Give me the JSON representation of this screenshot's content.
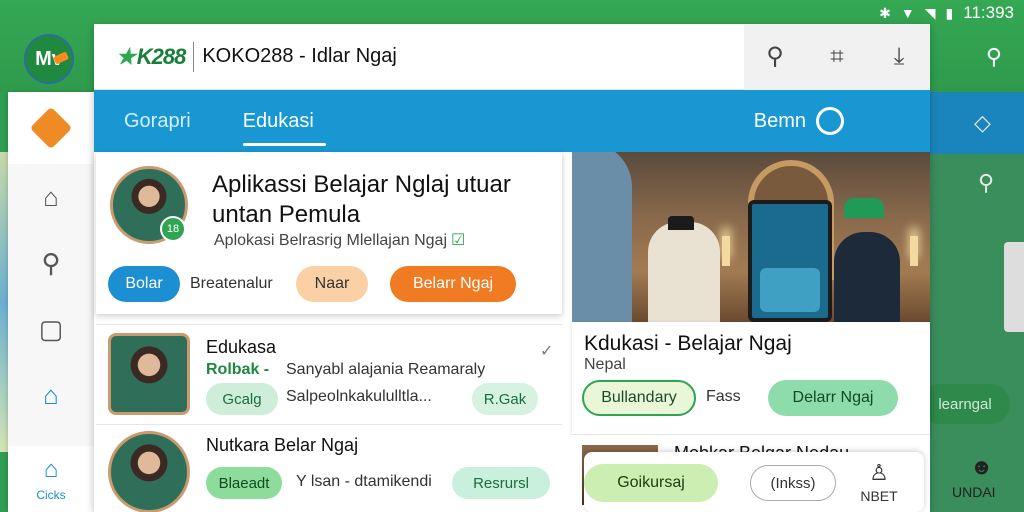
{
  "status_bar": {
    "time": "11:393",
    "icons": [
      "bluetooth-icon",
      "signal-icon",
      "wifi-icon",
      "battery-icon"
    ]
  },
  "app_logo": "Mv",
  "header": {
    "brand": "K288",
    "title": "KOKO288 - Idlar Ngaj",
    "tools": [
      "search-icon",
      "grid-icon",
      "download-icon"
    ]
  },
  "tabs": {
    "items": [
      {
        "label": "Gorapri"
      },
      {
        "label": "Edukasi"
      }
    ],
    "right_label": "Bemn"
  },
  "sidebar": {
    "bottom_label": "Cicks"
  },
  "hero": {
    "title": "Aplikassi Belajar Nglaj utuar untan Pemula",
    "subtitle": "Aplokasi Belrasrig Mlellajan Ngaj",
    "badge": "18",
    "btn_blue": "Bolar",
    "plain_text": "Breatenalur",
    "btn_peach": "Naar",
    "btn_orange": "Belarr Ngaj"
  },
  "list": [
    {
      "title": "Edukasa",
      "green_label": "Rolbak -",
      "line1": "Sanyabl alajania Reamaraly",
      "line2": "Salpeolnkakululltla...",
      "chip_left": "Gcalg",
      "chip_right": "R.Gak"
    },
    {
      "title": "Nutkara Belar Ngaj",
      "chip_left": "Blaeadt",
      "middle_text": "Y lsan - dtamikendi",
      "chip_right": "Resrursl"
    }
  ],
  "right_card": {
    "title": "Kdukasi - Belajar Ngaj",
    "subtitle": "Nepal",
    "btn_outline": "Bullandary",
    "plain_text": "Fass",
    "btn_green": "Delarr Ngaj"
  },
  "right_row": {
    "title": "Mobkar Belgar Nedau..."
  },
  "floating_bar": {
    "btn1": "Goikursaj",
    "btn2": "(Inkss)",
    "user_label": "NBET"
  },
  "bg_strip": {
    "pill": "learngal",
    "label": "UNDAI"
  },
  "colors": {
    "green": "#34a853",
    "blue": "#1897d3",
    "orange": "#f07b22"
  }
}
